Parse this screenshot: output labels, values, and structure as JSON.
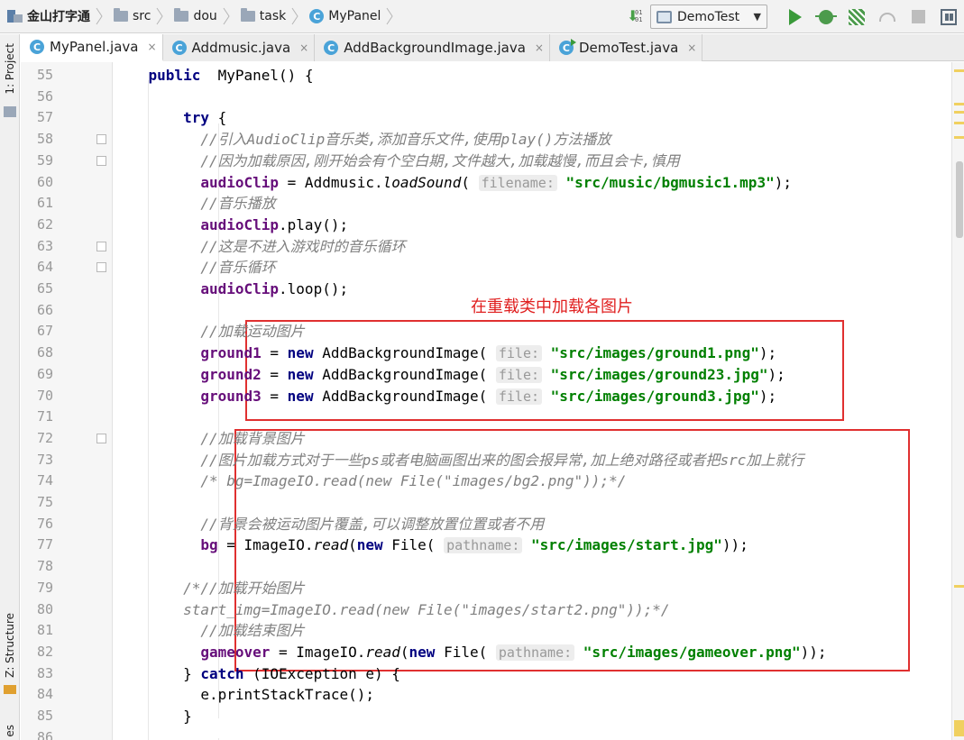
{
  "navbar": {
    "breadcrumbs": [
      "金山打字通",
      "src",
      "dou",
      "task",
      "MyPanel"
    ],
    "run_config": "DemoTest",
    "icons": [
      "project-icon",
      "folder-icon",
      "class-icon",
      "sort-icon",
      "run-icon",
      "debug-icon",
      "coverage-icon",
      "profile-icon",
      "stop-icon",
      "project-structure-icon"
    ]
  },
  "sidebar": {
    "top_label": "1: Project",
    "bottom_label": "Z: Structure",
    "cut_label": "es"
  },
  "tabs": [
    {
      "label": "MyPanel.java",
      "active": true
    },
    {
      "label": "Addmusic.java",
      "active": false
    },
    {
      "label": "AddBackgroundImage.java",
      "active": false
    },
    {
      "label": "DemoTest.java",
      "active": false
    }
  ],
  "tab_close_glyph": "×",
  "annotation": {
    "text": "在重载类中加载各图片",
    "color": "#e02020"
  },
  "editor": {
    "line_numbers": [
      "55",
      "56",
      "57",
      "58",
      "59",
      "60",
      "61",
      "62",
      "63",
      "64",
      "65",
      "66",
      "67",
      "68",
      "69",
      "70",
      "71",
      "72",
      "73",
      "74",
      "75",
      "76",
      "77",
      "78",
      "79",
      "80",
      "81",
      "82",
      "83",
      "84",
      "85",
      "86"
    ],
    "lines": [
      [
        {
          "t": "    "
        },
        {
          "t": "public",
          "c": "kw"
        },
        {
          "t": "  MyPanel() {"
        }
      ],
      [],
      [
        {
          "t": "        "
        },
        {
          "t": "try",
          "c": "kw"
        },
        {
          "t": " {"
        }
      ],
      [
        {
          "t": "          "
        },
        {
          "t": "//引入AudioClip音乐类,添加音乐文件,使用play()方法播放",
          "c": "cmt"
        }
      ],
      [
        {
          "t": "          "
        },
        {
          "t": "//因为加载原因,刚开始会有个空白期,文件越大,加载越慢,而且会卡,慎用",
          "c": "cmt"
        }
      ],
      [
        {
          "t": "          "
        },
        {
          "t": "audioClip",
          "c": "fld"
        },
        {
          "t": " = Addmusic."
        },
        {
          "t": "loadSound",
          "c": "st"
        },
        {
          "t": "( "
        },
        {
          "t": "filename:",
          "c": "hint"
        },
        {
          "t": " "
        },
        {
          "t": "\"src/music/bgmusic1.mp3\"",
          "c": "str"
        },
        {
          "t": ");"
        }
      ],
      [
        {
          "t": "          "
        },
        {
          "t": "//音乐播放",
          "c": "cmt"
        }
      ],
      [
        {
          "t": "          "
        },
        {
          "t": "audioClip",
          "c": "fld"
        },
        {
          "t": ".play();"
        }
      ],
      [
        {
          "t": "          "
        },
        {
          "t": "//这是不进入游戏时的音乐循环",
          "c": "cmt"
        }
      ],
      [
        {
          "t": "          "
        },
        {
          "t": "//音乐循环",
          "c": "cmt"
        }
      ],
      [
        {
          "t": "          "
        },
        {
          "t": "audioClip",
          "c": "fld"
        },
        {
          "t": ".loop();"
        }
      ],
      [],
      [
        {
          "t": "          "
        },
        {
          "t": "//加载运动图片",
          "c": "cmt"
        }
      ],
      [
        {
          "t": "          "
        },
        {
          "t": "ground1",
          "c": "fld"
        },
        {
          "t": " = "
        },
        {
          "t": "new",
          "c": "kw"
        },
        {
          "t": " AddBackgroundImage( "
        },
        {
          "t": "file:",
          "c": "hint"
        },
        {
          "t": " "
        },
        {
          "t": "\"src/images/ground1.png\"",
          "c": "str"
        },
        {
          "t": ");"
        }
      ],
      [
        {
          "t": "          "
        },
        {
          "t": "ground2",
          "c": "fld"
        },
        {
          "t": " = "
        },
        {
          "t": "new",
          "c": "kw"
        },
        {
          "t": " AddBackgroundImage( "
        },
        {
          "t": "file:",
          "c": "hint"
        },
        {
          "t": " "
        },
        {
          "t": "\"src/images/ground23.jpg\"",
          "c": "str"
        },
        {
          "t": ");"
        }
      ],
      [
        {
          "t": "          "
        },
        {
          "t": "ground3",
          "c": "fld"
        },
        {
          "t": " = "
        },
        {
          "t": "new",
          "c": "kw"
        },
        {
          "t": " AddBackgroundImage( "
        },
        {
          "t": "file:",
          "c": "hint"
        },
        {
          "t": " "
        },
        {
          "t": "\"src/images/ground3.jpg\"",
          "c": "str"
        },
        {
          "t": ");"
        }
      ],
      [],
      [
        {
          "t": "          "
        },
        {
          "t": "//加载背景图片",
          "c": "cmt"
        }
      ],
      [
        {
          "t": "          "
        },
        {
          "t": "//图片加载方式对于一些ps或者电脑画图出来的图会报异常,加上绝对路径或者把src加上就行",
          "c": "cmt"
        }
      ],
      [
        {
          "t": "          "
        },
        {
          "t": "/* bg=ImageIO.read(new File(\"images/bg2.png\"));*/",
          "c": "cmt"
        }
      ],
      [],
      [
        {
          "t": "          "
        },
        {
          "t": "//背景会被运动图片覆盖,可以调整放置位置或者不用",
          "c": "cmt"
        }
      ],
      [
        {
          "t": "          "
        },
        {
          "t": "bg",
          "c": "fld"
        },
        {
          "t": " = ImageIO."
        },
        {
          "t": "read",
          "c": "st"
        },
        {
          "t": "("
        },
        {
          "t": "new",
          "c": "kw"
        },
        {
          "t": " File( "
        },
        {
          "t": "pathname:",
          "c": "hint"
        },
        {
          "t": " "
        },
        {
          "t": "\"src/images/start.jpg\"",
          "c": "str"
        },
        {
          "t": "));"
        }
      ],
      [],
      [
        {
          "t": "        "
        },
        {
          "t": "/*//加载开始图片",
          "c": "cmt"
        }
      ],
      [
        {
          "t": "        "
        },
        {
          "t": "start_img=ImageIO.read(new File(\"images/start2.png\"));*/",
          "c": "cmt"
        }
      ],
      [
        {
          "t": "          "
        },
        {
          "t": "//加载结束图片",
          "c": "cmt"
        }
      ],
      [
        {
          "t": "          "
        },
        {
          "t": "gameover",
          "c": "fld"
        },
        {
          "t": " = ImageIO."
        },
        {
          "t": "read",
          "c": "st"
        },
        {
          "t": "("
        },
        {
          "t": "new",
          "c": "kw"
        },
        {
          "t": " File( "
        },
        {
          "t": "pathname:",
          "c": "hint"
        },
        {
          "t": " "
        },
        {
          "t": "\"src/images/gameover.png\"",
          "c": "str"
        },
        {
          "t": "));"
        }
      ],
      [
        {
          "t": "        } "
        },
        {
          "t": "catch",
          "c": "kw"
        },
        {
          "t": " (IOException e) {"
        }
      ],
      [
        {
          "t": "          e.printStackTrace();"
        }
      ],
      [
        {
          "t": "        }"
        }
      ],
      []
    ]
  }
}
